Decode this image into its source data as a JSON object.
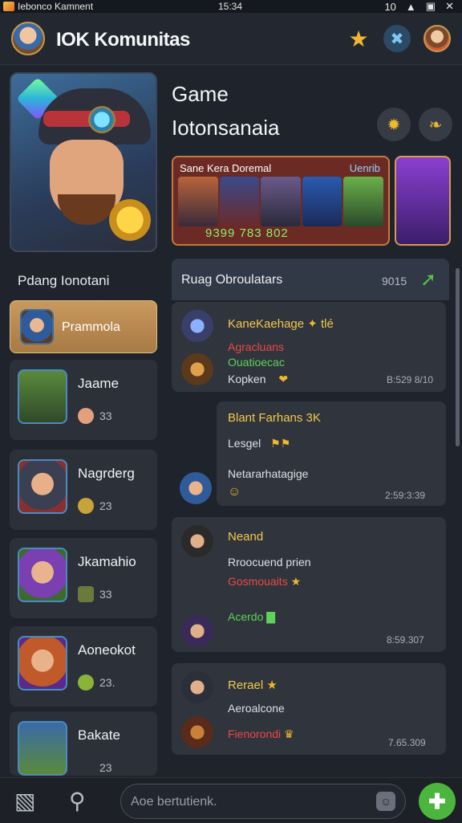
{
  "status_bar": {
    "app_name": "Iebonco Kamnent",
    "time": "15:34",
    "signal": "10",
    "wifi_icon": "wifi-icon",
    "box_icon": "box-icon",
    "close_icon": "close-icon"
  },
  "header": {
    "title": "IOK Komunitas",
    "icons": [
      "star-icon",
      "tool-icon",
      "profile-avatar"
    ]
  },
  "sidebar": {
    "section_label": "Pdang Ionotani",
    "active_item": {
      "name": "Prammola"
    },
    "items": [
      {
        "name": "Jaame",
        "count": "33"
      },
      {
        "name": "Nagrderg",
        "count": "23"
      },
      {
        "name": "Jkamahio",
        "count": "33"
      },
      {
        "name": "Aoneokot",
        "count": "23."
      },
      {
        "name": "Bakate",
        "count": "23"
      }
    ]
  },
  "game": {
    "title_line1": "Game",
    "title_line2": "Iotonsanaia",
    "banner": {
      "title": "Sane Kera Doremal",
      "tag": "Uenrib",
      "numbers": "9399 783 802"
    }
  },
  "panel": {
    "title": "Ruag Obroulatars",
    "number": "9015"
  },
  "messages": [
    {
      "title": "KaneKaehage",
      "suffix": "tlé",
      "line2": "Agracluans",
      "line3": "Ouatioecac",
      "line4": "Kopken",
      "time": "B:529 8/10"
    },
    {
      "title": "Blant Farhans 3K",
      "line2": "Lesgel",
      "line3": "Netararhatagige",
      "time": "2:59:3:39"
    },
    {
      "title": "Neand",
      "line2": "Rroocuend prien",
      "line3": "Gosmouaits",
      "line4": "Acerdo",
      "time": "8:59.307"
    },
    {
      "title": "Rerael",
      "line2": "Aeroalcone",
      "line3": "Fienorondi",
      "time": "7.65.309"
    }
  ],
  "bottom_bar": {
    "placeholder": "Aoe bertutienk."
  },
  "colors": {
    "accent_green": "#4cb53d",
    "gold": "#f3c94b",
    "alert_red": "#ea4a44",
    "panel_bg": "#2f343d"
  }
}
